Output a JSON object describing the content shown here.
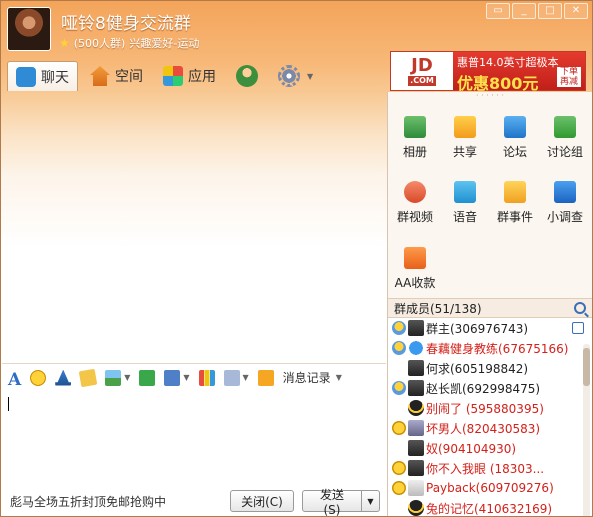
{
  "group": {
    "name": "哑铃8健身交流群",
    "member_count_label": "(500人群)",
    "interest_label": "兴趣爱好-运动"
  },
  "window_buttons": [
    "restore-icon",
    "chevron-down-icon",
    "maximize-icon",
    "close-icon"
  ],
  "tabs": [
    {
      "label": "聊天",
      "icon": "chat-icon",
      "active": true
    },
    {
      "label": "空间",
      "icon": "home-icon",
      "active": false
    },
    {
      "label": "应用",
      "icon": "apps-icon",
      "active": false
    }
  ],
  "ad": {
    "brand": "JD",
    "brand_sub": "京东",
    "brand_domain": ".COM",
    "headline": "惠普14.0英寸超极本",
    "promo": "优惠800元",
    "tag": "下单 再减"
  },
  "apps": [
    {
      "label": "相册",
      "icon": "photo-album-icon"
    },
    {
      "label": "共享",
      "icon": "folder-share-icon"
    },
    {
      "label": "论坛",
      "icon": "forum-icon"
    },
    {
      "label": "讨论组",
      "icon": "discussion-icon"
    },
    {
      "label": "群视频",
      "icon": "video-icon"
    },
    {
      "label": "语音",
      "icon": "voice-icon"
    },
    {
      "label": "群事件",
      "icon": "calendar-icon"
    },
    {
      "label": "小调查",
      "icon": "survey-icon"
    },
    {
      "label": "AA收款",
      "icon": "aa-payment-icon"
    }
  ],
  "members_header": "群成员(51/138)",
  "members": [
    {
      "name": "群主(306976743)",
      "red": false,
      "badge": "owner",
      "avatar": "dark",
      "indent": false
    },
    {
      "name": "春藕健身教练(67675166)",
      "red": true,
      "badge": "owner",
      "avatar": "blue",
      "indent": false
    },
    {
      "name": "何求(605198842)",
      "red": false,
      "badge": "",
      "avatar": "dark",
      "indent": true
    },
    {
      "name": "赵长凯(692998475)",
      "red": false,
      "badge": "owner",
      "avatar": "dark",
      "indent": false
    },
    {
      "name": "别闹了  (595880395)",
      "red": true,
      "badge": "",
      "avatar": "penguin",
      "indent": true
    },
    {
      "name": "坏男人(820430583)",
      "red": true,
      "badge": "star",
      "avatar": "light",
      "indent": false
    },
    {
      "name": "奴(904104930)",
      "red": true,
      "badge": "",
      "avatar": "dark",
      "indent": true
    },
    {
      "name": "你不入我眼  (18303...",
      "red": true,
      "badge": "star",
      "avatar": "dark",
      "indent": false
    },
    {
      "name": "Payback(609709276)",
      "red": true,
      "badge": "star",
      "avatar": "pale",
      "indent": false
    },
    {
      "name": "兔的记忆(410632169)",
      "red": true,
      "badge": "",
      "avatar": "penguin",
      "indent": true
    }
  ],
  "format_toolbar": {
    "history_label": "消息记录"
  },
  "bottom": {
    "promo_text": "彪马全场五折封顶免邮抢购中",
    "close_label": "关闭(C)",
    "send_label": "发送(S)"
  }
}
